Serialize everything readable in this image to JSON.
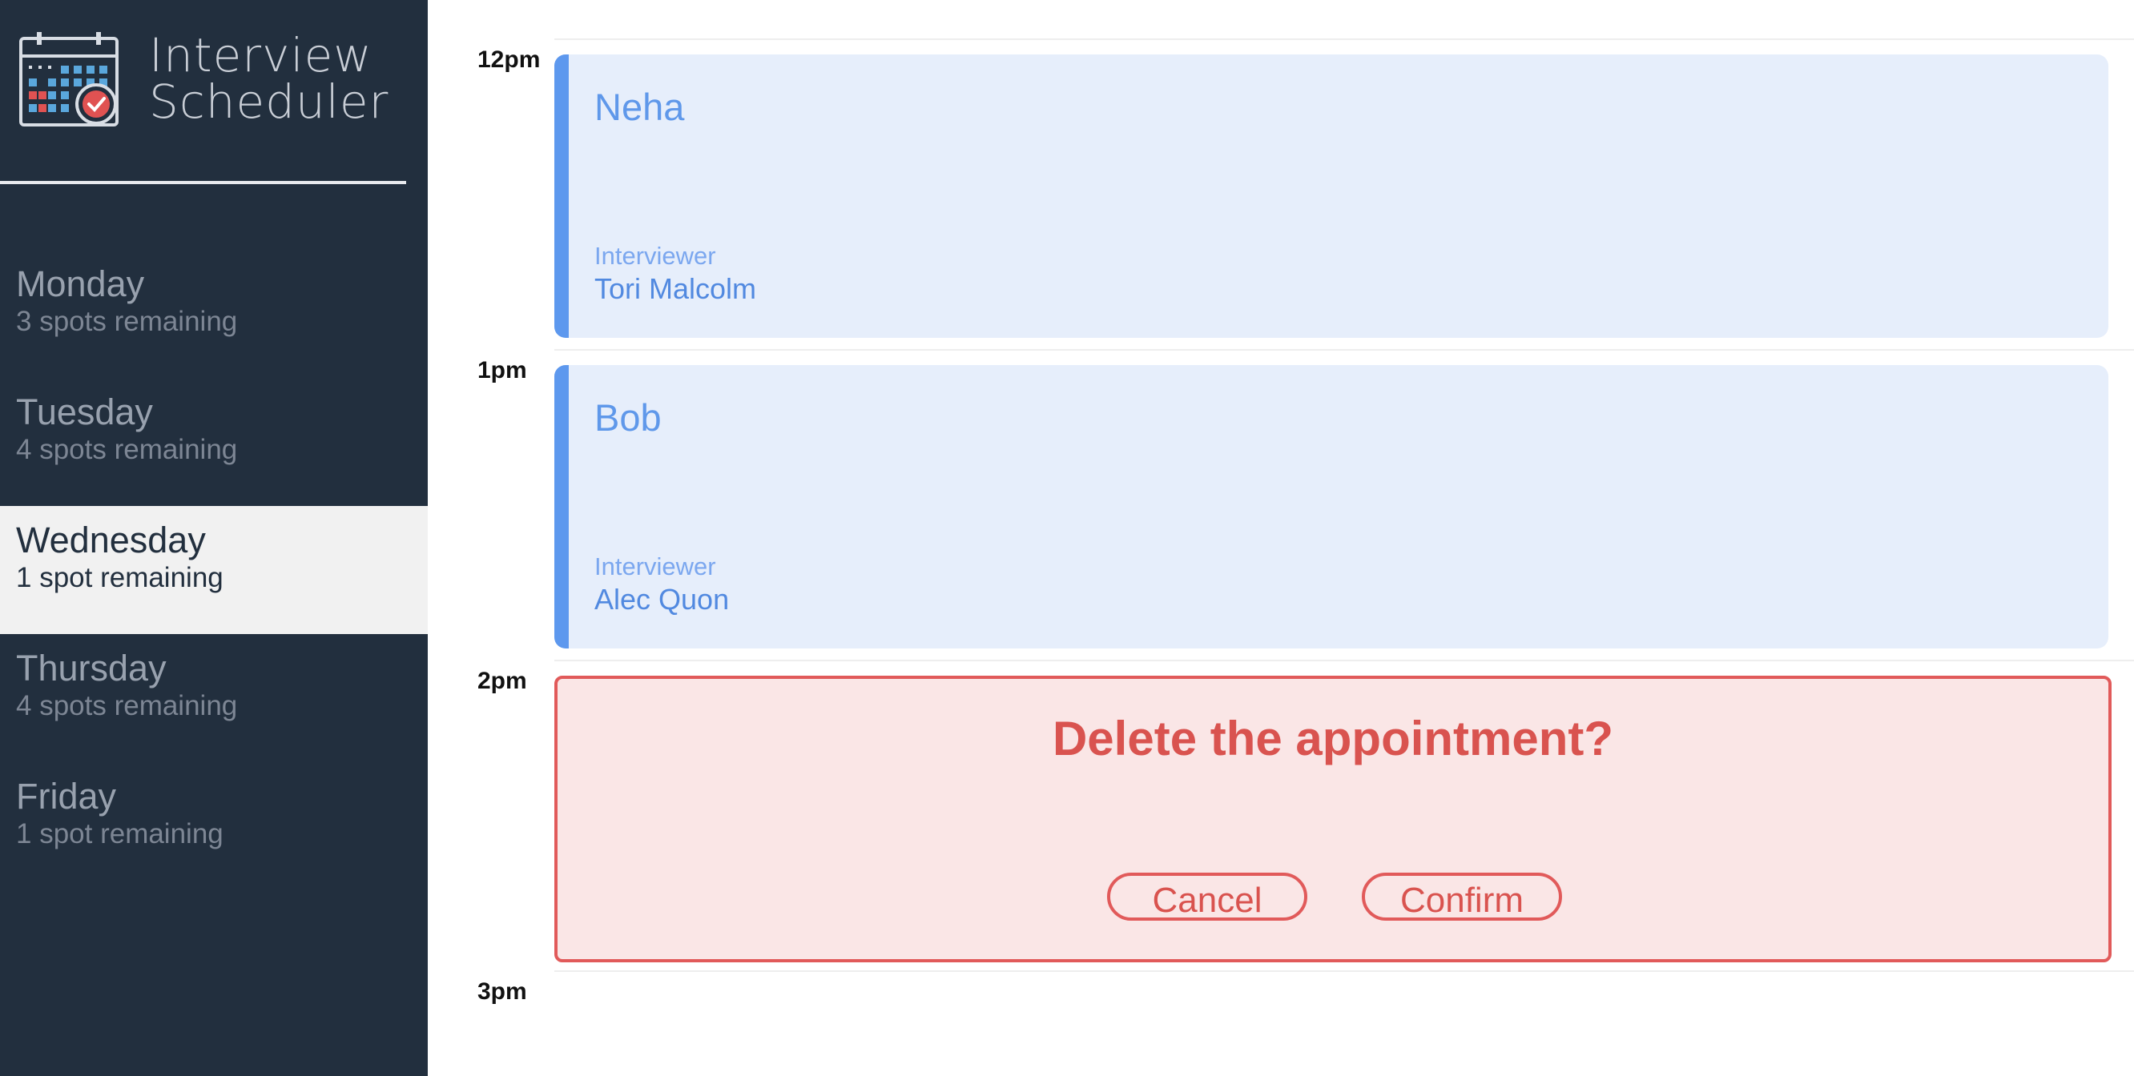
{
  "app": {
    "title_line1": "Interview",
    "title_line2": "Scheduler",
    "logo_icon": "calendar-check-icon"
  },
  "days": [
    {
      "name": "Monday",
      "spots": "3 spots remaining",
      "selected": false
    },
    {
      "name": "Tuesday",
      "spots": "4 spots remaining",
      "selected": false
    },
    {
      "name": "Wednesday",
      "spots": "1 spot remaining",
      "selected": true
    },
    {
      "name": "Thursday",
      "spots": "4 spots remaining",
      "selected": false
    },
    {
      "name": "Friday",
      "spots": "1 spot remaining",
      "selected": false
    }
  ],
  "schedule": {
    "times": [
      "12pm",
      "1pm",
      "2pm",
      "3pm"
    ],
    "appointments": [
      {
        "student": "Neha",
        "interviewer_label": "Interviewer",
        "interviewer": "Tori Malcolm"
      },
      {
        "student": "Bob",
        "interviewer_label": "Interviewer",
        "interviewer": "Alec Quon"
      }
    ],
    "confirm": {
      "message": "Delete the appointment?",
      "cancel_label": "Cancel",
      "confirm_label": "Confirm"
    }
  },
  "colors": {
    "sidebar_bg": "#222f3e",
    "accent_blue": "#5d98ee",
    "danger_red": "#d9534f"
  }
}
